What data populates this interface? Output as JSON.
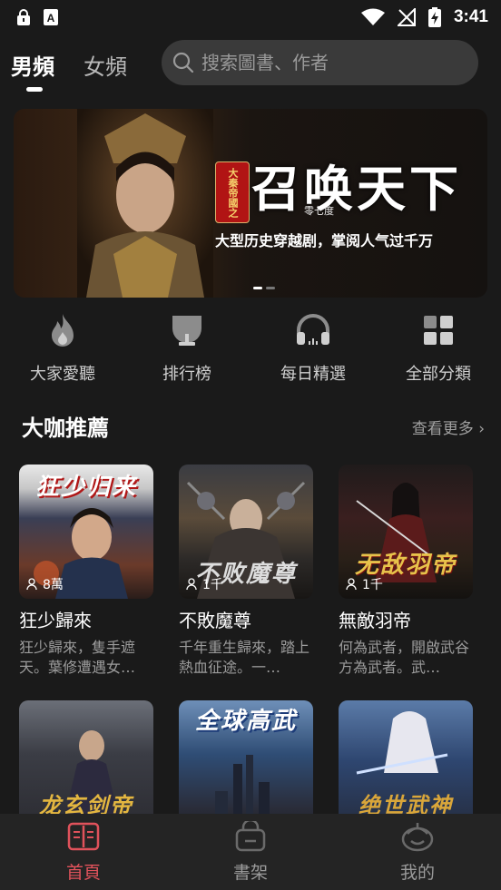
{
  "status_bar": {
    "time": "3:41",
    "left_icons": [
      "lock-icon",
      "font-a-icon"
    ],
    "right_icons": [
      "wifi-icon",
      "no-signal-icon",
      "battery-charging-icon"
    ]
  },
  "header": {
    "tabs": [
      {
        "label": "男頻",
        "active": true
      },
      {
        "label": "女頻",
        "active": false
      }
    ],
    "search_placeholder": "搜索圖書、作者"
  },
  "banner": {
    "badge": "大秦帝國之",
    "title": "召唤天下",
    "subtitle": "零七度",
    "tagline": "大型历史穿越剧，掌阅人气过千万",
    "page_count": 2,
    "active_page": 0
  },
  "quick_nav": [
    {
      "label": "大家愛聽",
      "icon": "flame-icon"
    },
    {
      "label": "排行榜",
      "icon": "trophy-icon"
    },
    {
      "label": "每日精選",
      "icon": "headphones-icon"
    },
    {
      "label": "全部分類",
      "icon": "grid-icon"
    }
  ],
  "section": {
    "title": "大咖推薦",
    "more": "查看更多"
  },
  "books": [
    {
      "name": "狂少歸來",
      "cover_text": "狂少归来",
      "readers": "8萬",
      "desc": "狂少歸來，隻手遮天。葉修遭遇女…"
    },
    {
      "name": "不敗魔尊",
      "cover_text": "不败魔尊",
      "readers": "1千",
      "desc": "千年重生歸來，踏上熱血征途。一…"
    },
    {
      "name": "無敵羽帝",
      "cover_text": "无敌羽帝",
      "readers": "1千",
      "desc": "何為武者，開啟武谷方為武者。武…"
    },
    {
      "name": "",
      "cover_text": "龙玄剑帝",
      "readers": "",
      "desc": ""
    },
    {
      "name": "",
      "cover_text": "全球高武",
      "readers": "",
      "desc": ""
    },
    {
      "name": "",
      "cover_text": "绝世武神",
      "readers": "",
      "desc": ""
    }
  ],
  "bottom_nav": [
    {
      "label": "首頁",
      "icon": "book-open-icon",
      "active": true
    },
    {
      "label": "書架",
      "icon": "bookshelf-bag-icon",
      "active": false
    },
    {
      "label": "我的",
      "icon": "profile-icon",
      "active": false
    }
  ],
  "colors": {
    "background": "#1a1a1a",
    "accent": "#e0525b",
    "search_bg": "#3a3a3a",
    "nav_bg": "#242424"
  }
}
